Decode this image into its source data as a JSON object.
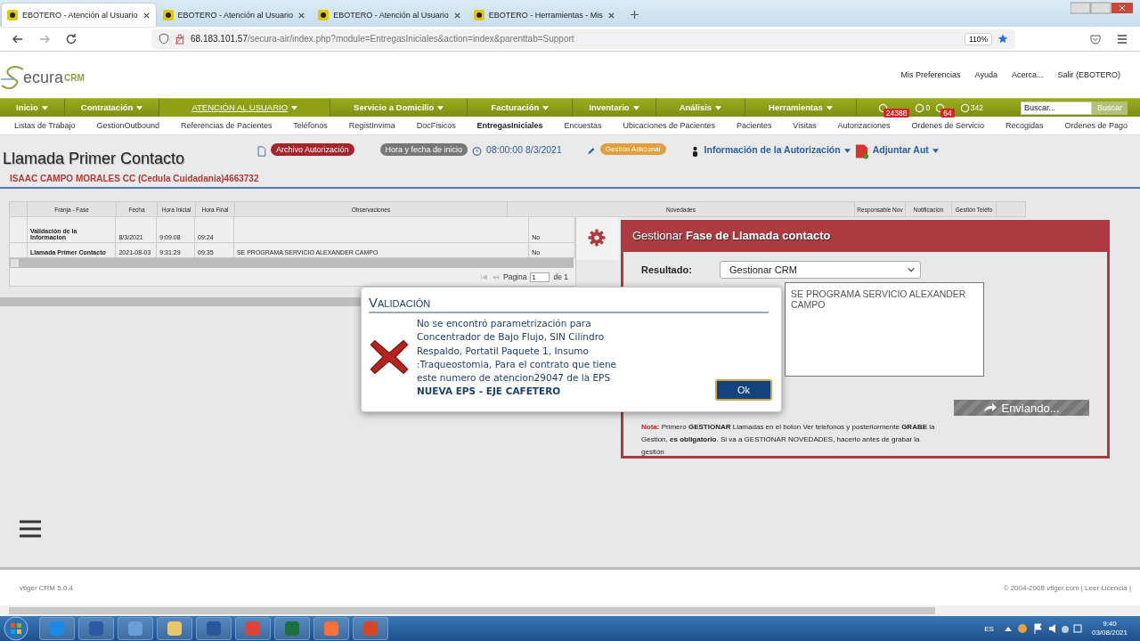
{
  "browser": {
    "tabs": [
      {
        "title": "EBOTERO - Atención al Usuario",
        "selected": true
      },
      {
        "title": "EBOTERO - Atención al Usuario",
        "selected": false
      },
      {
        "title": "EBOTERO - Atención al Usuario",
        "selected": false
      },
      {
        "title": "EBOTERO - Herramientas - Mis",
        "selected": false
      }
    ],
    "url_host": "68.183.101.57",
    "url_path": "/secura-air/index.php?module=EntregasIniciales&action=index&parenttab=Support",
    "zoom": "110%"
  },
  "app": {
    "logo": {
      "name": "ecura",
      "suffix": "CRM"
    },
    "top_links": [
      "Mis Preferencias",
      "Ayuda",
      "Acerca...",
      "Salir (EBOTERO)"
    ],
    "menu": [
      {
        "label": "Inicio",
        "selected": false
      },
      {
        "label": "Contratación",
        "selected": false
      },
      {
        "label": "ATENCIÓN AL USUARIO",
        "selected": true
      },
      {
        "label": "Servicio a Domicilio",
        "selected": false
      },
      {
        "label": "Facturación",
        "selected": false
      },
      {
        "label": "Inventario",
        "selected": false
      },
      {
        "label": "Análisis",
        "selected": false
      },
      {
        "label": "Herramientas",
        "selected": false
      }
    ],
    "counters": [
      {
        "badge": "24388"
      },
      {
        "count": "0"
      },
      {
        "badge": "64"
      },
      {
        "count": "342"
      }
    ],
    "search": {
      "placeholder": "Buscar...",
      "button": "Buscar"
    },
    "submenu": [
      {
        "label": "Listas de Trabajo",
        "selected": false
      },
      {
        "label": "GestionOutbound",
        "selected": false
      },
      {
        "label": "Referencias de Pacientes",
        "selected": false
      },
      {
        "label": "Teléfonos",
        "selected": false
      },
      {
        "label": "RegistInvima",
        "selected": false
      },
      {
        "label": "DocFisicos",
        "selected": false
      },
      {
        "label": "EntregasIniciales",
        "selected": true
      },
      {
        "label": "Encuestas",
        "selected": false
      },
      {
        "label": "Ubicaciones de Pacientes",
        "selected": false
      },
      {
        "label": "Pacientes",
        "selected": false
      },
      {
        "label": "Visitas",
        "selected": false
      },
      {
        "label": "Autorizaciones",
        "selected": false
      },
      {
        "label": "Ordenes de Servicio",
        "selected": false
      },
      {
        "label": "Recogidas",
        "selected": false
      },
      {
        "label": "Ordenes de Pago",
        "selected": false
      }
    ]
  },
  "record": {
    "title": "Llamada Primer Contacto",
    "subtitle": "ISAAC CAMPO MORALES CC (Cedula Cuidadania)4663732",
    "archivo": "Archivo Autorización",
    "start_label": "Hora y fecha de inicio",
    "start_value": "08:00:00 8/3/2021",
    "gestion_adicional": "Gestión Adicional",
    "info": "Información de la Autorización",
    "adjuntar": "Adjuntar Aut"
  },
  "table": {
    "columns": [
      "Franja - Fase",
      "Fecha",
      "Hora Inicial",
      "Hora Final",
      "Observaciones",
      "Novedades",
      "Responsable Nov",
      "Notificación",
      "Gestión Teléfo"
    ],
    "rows": [
      [
        "Validación de la Informacion",
        "8/3/2021",
        "9:09:08",
        "09:24",
        "",
        "No"
      ],
      [
        "Llamada Primer Contacto",
        "2021-08-03",
        "9:31:29",
        "09:35",
        "SE PROGRAMA SERVICIO ALEXANDER CAMPO",
        "No"
      ]
    ],
    "pager": {
      "label": "Pagina",
      "page": "1",
      "of": "de 1"
    }
  },
  "panel": {
    "title": "Gestionar **Fase de Llamada contacto**",
    "resultado_label": "Resultado:",
    "resultado": "Gestionar CRM",
    "observaciones": "SE PROGRAMA SERVICIO ALEXANDER CAMPO",
    "send": "Enviando...",
    "note": "**Nota:** Primero **GESTIONAR** Llamadas en el boton Ver telefonos y posteriormente **GRABE** la Gestion, **es obligatorio**. Si va a GESTIONAR NOVEDADES, hacerlo antes de grabar la gestión"
  },
  "dialog": {
    "title": "Validación",
    "message": "No se encontró parametrización para Concentrador de Bajo Flujo, SIN Cilindro Respaldo, Portatil Paquete 1, Insumo :Traqueostomia, Para el contrato que tiene este numero de atencion29047 de la EPS",
    "emphasis": "NUEVA EPS - EJE CAFETERO",
    "button": "Ok"
  },
  "footer": {
    "version": "vtiger CRM 5.0.4",
    "copyright": "© 2004-2008 vtiger.com | Leer Licencia |"
  },
  "taskbar": {
    "language": "ES",
    "time": "9:40",
    "date": "03/08/2021"
  }
}
